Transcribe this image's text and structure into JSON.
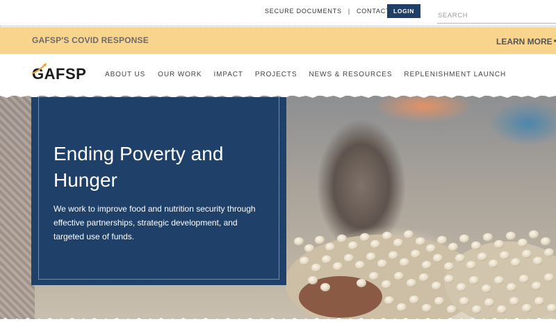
{
  "utility": {
    "secure_documents": "SECURE DOCUMENTS",
    "separator": "|",
    "contact": "CONTACT",
    "login": "LOGIN",
    "search_placeholder": "SEARCH"
  },
  "banner": {
    "title": "GAFSP'S COVID RESPONSE",
    "learn_more": "LEARN MORE",
    "plus_icon": "plus-icon"
  },
  "nav": {
    "logo_text": "GAFSP",
    "items": [
      {
        "label": "ABOUT US"
      },
      {
        "label": "OUR WORK"
      },
      {
        "label": "IMPACT"
      },
      {
        "label": "PROJECTS"
      },
      {
        "label": "NEWS & RESOURCES"
      },
      {
        "label": "REPLENISHMENT LAUNCH"
      }
    ]
  },
  "hero": {
    "title": "Ending Poverty and Hunger",
    "body": "We work to improve food and nutrition security through effective partnerships, strategic development, and targeted use of funds."
  },
  "colors": {
    "navy": "#1f4069",
    "banner": "#f9d48d",
    "login": "#1f3f66"
  }
}
